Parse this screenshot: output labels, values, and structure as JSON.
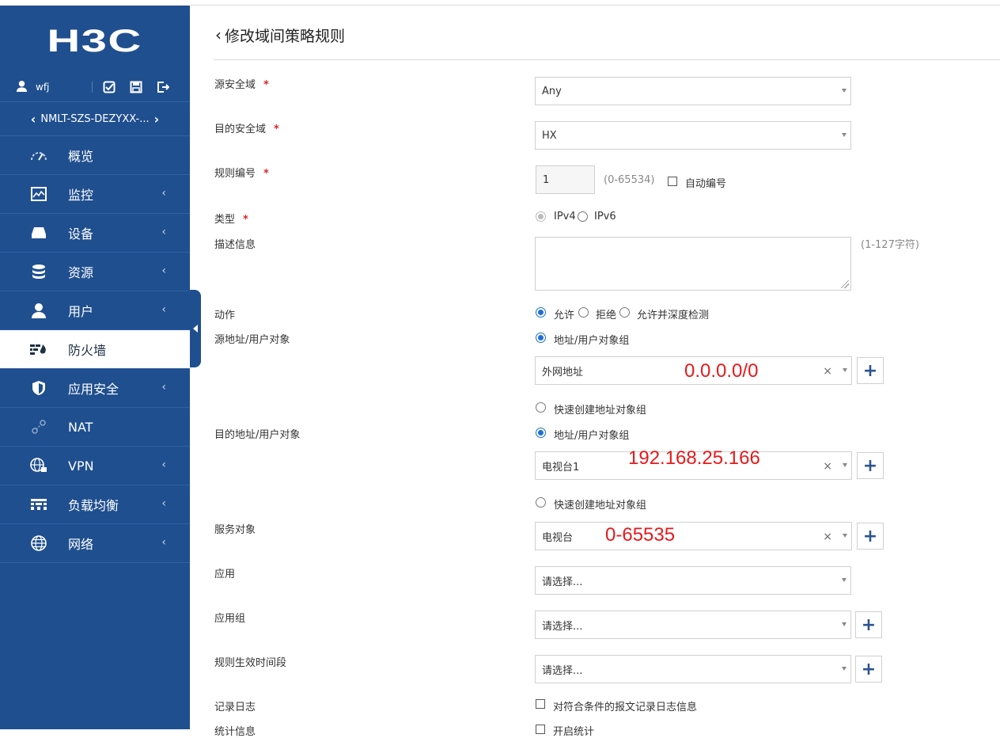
{
  "sidebar": {
    "logo": "H3C",
    "user": "wfj",
    "device": "NMLT-SZS-DEZYXX-...",
    "items": [
      {
        "label": "概览",
        "icon": "gauge-icon",
        "chevron": false
      },
      {
        "label": "监控",
        "icon": "monitor-chart-icon",
        "chevron": true
      },
      {
        "label": "设备",
        "icon": "device-icon",
        "chevron": true
      },
      {
        "label": "资源",
        "icon": "database-icon",
        "chevron": true
      },
      {
        "label": "用户",
        "icon": "user-icon",
        "chevron": true
      },
      {
        "label": "防火墙",
        "icon": "firewall-icon",
        "chevron": false,
        "active": true
      },
      {
        "label": "应用安全",
        "icon": "shield-icon",
        "chevron": true
      },
      {
        "label": "NAT",
        "icon": "nat-link-icon",
        "chevron": false
      },
      {
        "label": "VPN",
        "icon": "globe-lock-icon",
        "chevron": true
      },
      {
        "label": "负载均衡",
        "icon": "load-balance-icon",
        "chevron": true
      },
      {
        "label": "网络",
        "icon": "globe-icon",
        "chevron": true
      }
    ],
    "chevron_glyph": "‹",
    "accent": "#1f4f8f"
  },
  "page": {
    "back": "‹",
    "title": "修改域间策略规则"
  },
  "form": {
    "required_mark": "*",
    "src_zone": {
      "label": "源安全域",
      "value": "Any"
    },
    "dst_zone": {
      "label": "目的安全域",
      "value": "HX"
    },
    "rule_id": {
      "label": "规则编号",
      "value": "1",
      "range": "(0-65534)",
      "auto_label": "自动编号"
    },
    "type": {
      "label": "类型",
      "opt1": "IPv4",
      "opt2": "IPv6"
    },
    "description": {
      "label": "描述信息",
      "hint": "(1-127字符)"
    },
    "action": {
      "label": "动作",
      "opt1": "允许",
      "opt2": "拒绝",
      "opt3": "允许并深度检测"
    },
    "src_addr": {
      "label": "源地址/用户对象",
      "opt_group": "地址/用户对象组",
      "value": "外网地址",
      "overlay": "0.0.0.0/0",
      "opt_quick": "快速创建地址对象组"
    },
    "dst_addr": {
      "label": "目的地址/用户对象",
      "opt_group": "地址/用户对象组",
      "value": "电视台1",
      "overlay": "192.168.25.166",
      "opt_quick": "快速创建地址对象组"
    },
    "service": {
      "label": "服务对象",
      "value": "电视台",
      "overlay": "0-65535"
    },
    "app": {
      "label": "应用",
      "placeholder": "请选择..."
    },
    "app_group": {
      "label": "应用组",
      "placeholder": "请选择..."
    },
    "time_range": {
      "label": "规则生效时间段",
      "placeholder": "请选择..."
    },
    "log": {
      "label": "记录日志",
      "option": "对符合条件的报文记录日志信息"
    },
    "stats": {
      "label": "统计信息",
      "option": "开启统计"
    },
    "clear_glyph": "×",
    "plus_glyph": "+"
  }
}
